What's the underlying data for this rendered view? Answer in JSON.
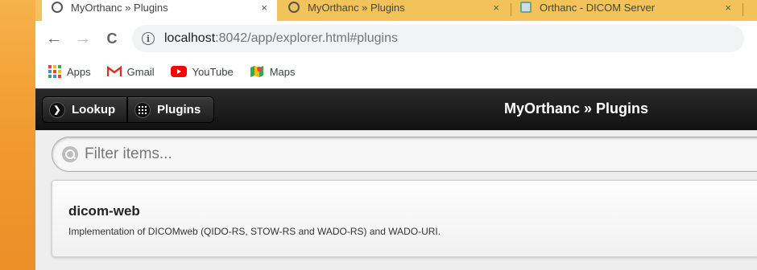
{
  "browser": {
    "tabs": [
      {
        "title": "MyOrthanc » Plugins",
        "close": "×",
        "active": true
      },
      {
        "title": "MyOrthanc » Plugins",
        "close": "×",
        "active": false
      },
      {
        "title": "Orthanc - DICOM Server",
        "close": "×",
        "active": false
      }
    ],
    "nav": {
      "back": "←",
      "forward": "→",
      "reload": "C"
    },
    "url": {
      "host": "localhost",
      "rest": ":8042/app/explorer.html#plugins"
    },
    "bookmarks": [
      {
        "label": "Apps",
        "icon": "apps-grid-icon"
      },
      {
        "label": "Gmail",
        "icon": "gmail-icon"
      },
      {
        "label": "YouTube",
        "icon": "youtube-icon"
      },
      {
        "label": "Maps",
        "icon": "maps-icon"
      }
    ]
  },
  "header": {
    "lookup_label": "Lookup",
    "plugins_label": "Plugins",
    "title": "MyOrthanc » Plugins"
  },
  "filter": {
    "placeholder": "Filter items..."
  },
  "plugins": [
    {
      "name": "dicom-web",
      "description": "Implementation of DICOMweb (QIDO-RS, STOW-RS and WADO-RS) and WADO-URI."
    }
  ],
  "colors": {
    "tabstrip": "#f1c35a",
    "header_bg": "#111111",
    "desktop": "#f2a33a"
  }
}
